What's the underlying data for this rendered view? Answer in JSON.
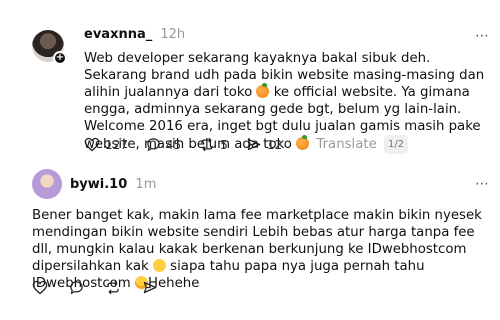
{
  "post1": {
    "username": "evaxnna_",
    "time": "12h",
    "text_before_emoji1": "Web developer sekarang kayaknya bakal sibuk deh. Sekarang brand udh pada bikin website masing-masing dan alihin jualannya dari toko",
    "text_after_emoji1": " ke official website. Ya gimana engga, adminnya sekarang gede bgt, belum yg lain-lain. Welcome 2016 era, inget bgt dulu jualan gamis masih pake website, masih belum ada toko",
    "translate": "Translate",
    "page_indicator": "1/2",
    "likes": "127",
    "replies": "45",
    "reposts": "5",
    "shares": "12"
  },
  "post2": {
    "username": "bywi.10",
    "time": "1m",
    "text_part1": "Bener banget kak, makin lama fee marketplace makin bikin nyesek mendingan bikin website sendiri Lebih bebas atur harga tanpa fee dll, mungkin kalau kakak berkenan berkunjung ke IDwebhostcom dipersilahkan kak",
    "text_part2": " siapa tahu papa nya juga pernah tahu IDwebhostcom",
    "text_part3": "Hehehe"
  },
  "icons": {
    "more": "⋯"
  },
  "colors": {
    "text": "#101010",
    "muted": "#999999",
    "orange_emoji": "#f07e13"
  }
}
